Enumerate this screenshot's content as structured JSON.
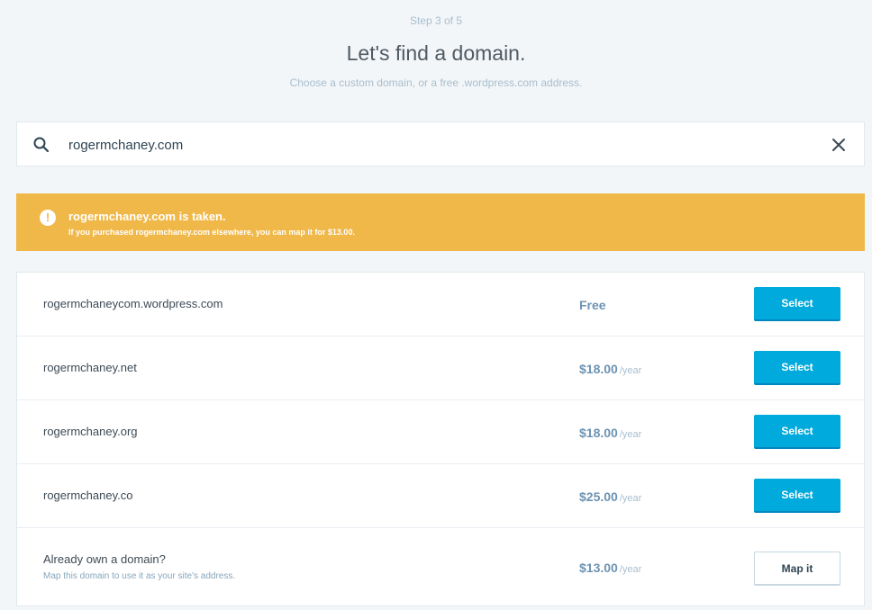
{
  "header": {
    "step": "Step 3 of 5",
    "title": "Let's find a domain.",
    "subtitle": "Choose a custom domain, or a free .wordpress.com address."
  },
  "search": {
    "value": "rogermchaney.com",
    "icon": "search-icon",
    "clear_icon": "close-icon"
  },
  "notice": {
    "color": "#f0b849",
    "icon": "alert-icon",
    "title": "rogermchaney.com is taken.",
    "text": "If you purchased rogermchaney.com elsewhere, you can map it for $13.00."
  },
  "results": [
    {
      "domain": "rogermchaneycom.wordpress.com",
      "price": "Free",
      "per": "",
      "button": "Select"
    },
    {
      "domain": "rogermchaney.net",
      "price": "$18.00",
      "per": "/year",
      "button": "Select"
    },
    {
      "domain": "rogermchaney.org",
      "price": "$18.00",
      "per": "/year",
      "button": "Select"
    },
    {
      "domain": "rogermchaney.co",
      "price": "$25.00",
      "per": "/year",
      "button": "Select"
    }
  ],
  "map_domain": {
    "title": "Already own a domain?",
    "subtitle": "Map this domain to use it as your site's address.",
    "price": "$13.00",
    "per": "/year",
    "button": "Map it"
  },
  "colors": {
    "accent": "#00aadc",
    "warning": "#f0b849",
    "price": "#6d93b2"
  }
}
